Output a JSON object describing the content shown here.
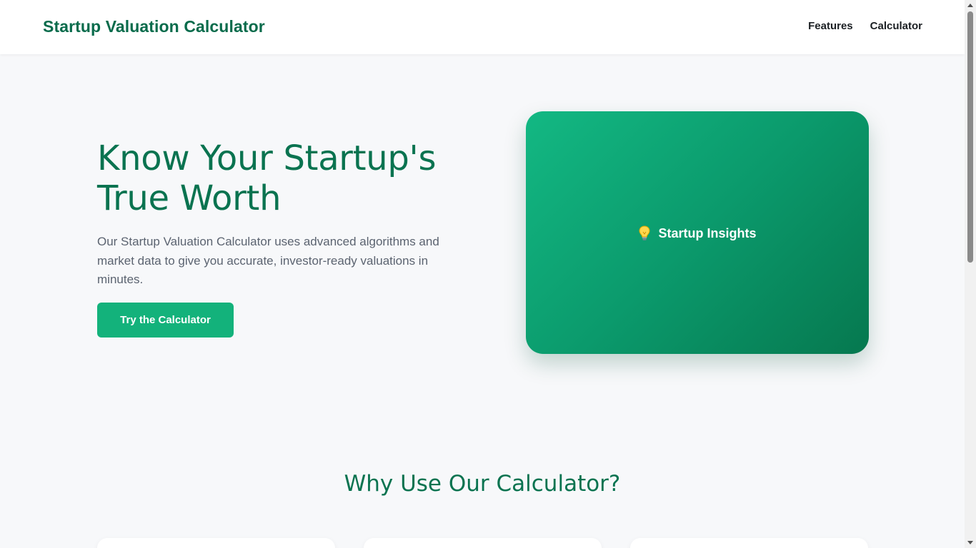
{
  "header": {
    "brand": "Startup Valuation Calculator",
    "nav": [
      "Features",
      "Calculator"
    ]
  },
  "hero": {
    "title": "Know Your Startup's True Worth",
    "description": "Our Startup Valuation Calculator uses advanced algorithms and market data to give you accurate, investor-ready valuations in minutes.",
    "cta_label": "Try the Calculator"
  },
  "insight_card": {
    "icon": "lightbulb-icon",
    "title": "Startup Insights"
  },
  "why_section": {
    "title": "Why Use Our Calculator?"
  },
  "colors": {
    "brand_green": "#086b4b",
    "accent_green": "#13b27b",
    "background": "#f7f8fa"
  }
}
